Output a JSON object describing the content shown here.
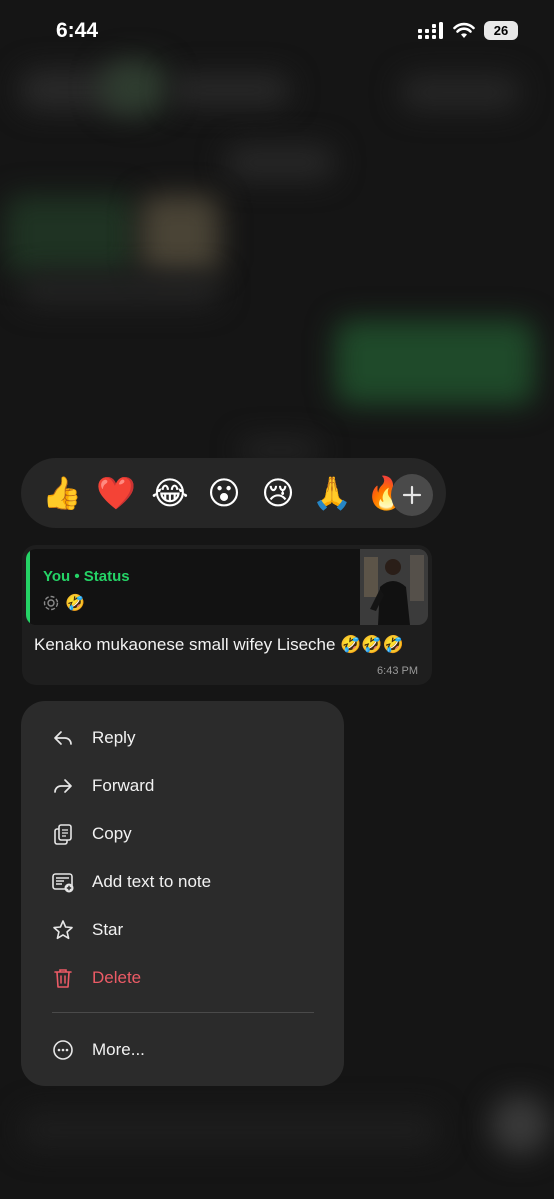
{
  "status_bar": {
    "time": "6:44",
    "battery": "26"
  },
  "reactions": {
    "emojis": [
      "👍",
      "❤️",
      "😂",
      "😮",
      "😢",
      "🙏",
      "🔥"
    ],
    "more_label": "+"
  },
  "message": {
    "quote": {
      "title": "You • Status",
      "body_emoji": "🤣"
    },
    "text": "Kenako mukaonese small wifey Liseche 🤣🤣🤣",
    "time": "6:43 PM"
  },
  "menu": {
    "items": [
      {
        "label": "Reply",
        "icon": "reply-icon"
      },
      {
        "label": "Forward",
        "icon": "forward-icon"
      },
      {
        "label": "Copy",
        "icon": "copy-icon"
      },
      {
        "label": "Add text to note",
        "icon": "note-add-icon"
      },
      {
        "label": "Star",
        "icon": "star-icon"
      },
      {
        "label": "Delete",
        "icon": "trash-icon"
      }
    ],
    "more_label": "More..."
  },
  "colors": {
    "accent": "#25d366",
    "danger": "#ec5b66",
    "menu_bg": "#2b2b2b"
  }
}
